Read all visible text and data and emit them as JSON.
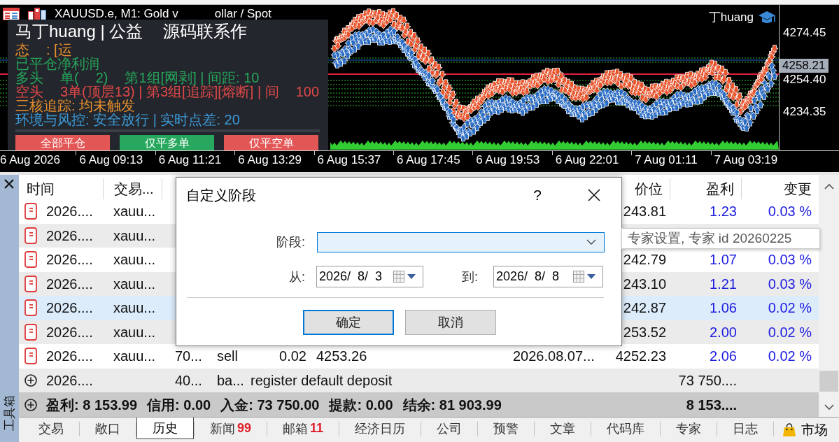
{
  "chart": {
    "title_parts": [
      "XAUUSD.e, M1: Gold v",
      "ollar / Spot"
    ],
    "author": "丁huang",
    "panel": {
      "lines": [
        {
          "color": "#ffffff",
          "parts": [
            "马丁huang | 公益",
            "源码联系作"
          ]
        },
        {
          "color": "#e8902e",
          "parts": [
            "态",
            ": [运"
          ]
        },
        {
          "color": "#26a65b",
          "parts": [
            "已平仓净利润"
          ]
        },
        {
          "color": "#26a65b",
          "parts": [
            "多头",
            "单(",
            "2)",
            "第1组[网剥] | 间距: 10"
          ]
        },
        {
          "color": "#e04848",
          "parts": [
            "空头",
            "3单(顶层13) | 第3组[追踪][熔断] | 间",
            "100"
          ]
        },
        {
          "color": "#e8902e",
          "parts": [
            "三核追踪: 均未触发"
          ]
        },
        {
          "color": "#3c9ad8",
          "parts": [
            "环境与风控: 安全放行 | 实时点差: 20"
          ]
        }
      ],
      "buttons": [
        {
          "label": "全部平仓",
          "color": "#e35656"
        },
        {
          "label": "仅平多单",
          "color": "#27a85e"
        },
        {
          "label": "仅平空单",
          "color": "#e35656"
        }
      ]
    },
    "price_ticks": [
      "4274.45",
      "4254.40",
      "4234.35"
    ],
    "current_price": "4258.21",
    "time_ticks": [
      "6 Aug 2026",
      "6 Aug 09:13",
      "6 Aug 11:21",
      "6 Aug 13:29",
      "6 Aug 15:37",
      "6 Aug 17:45",
      "6 Aug 19:53",
      "6 Aug 22:01",
      "7 Aug 01:11",
      "7 Aug 03:19"
    ]
  },
  "toolbox": {
    "title": "工具箱",
    "table": {
      "header": {
        "time": "时间",
        "symbol": "交易...",
        "close_price": "价位",
        "profit": "盈利",
        "change": "变更"
      },
      "rows": [
        {
          "kind": "deal",
          "selected": false,
          "time": "2026....",
          "symbol": "xauu...",
          "close_price": "243.81",
          "profit": "1.23",
          "change": "0.03 %"
        },
        {
          "kind": "deal",
          "selected": false,
          "time": "2026....",
          "symbol": "xauu..."
        },
        {
          "kind": "deal",
          "selected": false,
          "time": "2026....",
          "symbol": "xauu...",
          "close_price": "242.79",
          "profit": "1.07",
          "change": "0.03 %"
        },
        {
          "kind": "deal",
          "selected": false,
          "time": "2026....",
          "symbol": "xauu...",
          "close_price": "243.10",
          "profit": "1.21",
          "change": "0.03 %"
        },
        {
          "kind": "deal",
          "selected": true,
          "time": "2026....",
          "symbol": "xauu...",
          "close_price": "242.87",
          "profit": "1.06",
          "change": "0.02 %"
        },
        {
          "kind": "deal",
          "selected": false,
          "time": "2026....",
          "symbol": "xauu...",
          "close_price": "253.52",
          "profit": "2.00",
          "change": "0.02 %"
        },
        {
          "kind": "deal",
          "selected": false,
          "time": "2026....",
          "symbol": "xauu...",
          "ticket": "70...",
          "type": "sell",
          "volume": "0.02",
          "open_price": "4253.26",
          "close_time": "2026.08.07...",
          "close_price": "4252.23",
          "profit": "2.06",
          "change": "0.02 %"
        },
        {
          "kind": "balance",
          "selected": false,
          "time": "2026....",
          "ticket": "40...",
          "type": "ba...",
          "comment": "register default deposit",
          "profit": "73 750...."
        }
      ],
      "summary": {
        "items": [
          "盈利: 8 153.99",
          "信用: 0.00",
          "入金: 73 750.00",
          "提款: 0.00",
          "结余: 81 903.99"
        ],
        "profit": "8 153...."
      }
    },
    "tabs": [
      {
        "label": "交易",
        "selected": false
      },
      {
        "label": "敞口",
        "selected": false
      },
      {
        "label": "历史",
        "selected": true
      },
      {
        "label": "新闻",
        "badge": "99",
        "selected": false
      },
      {
        "label": "邮箱",
        "badge": "11",
        "selected": false
      },
      {
        "label": "经济日历",
        "selected": false
      },
      {
        "label": "公司",
        "selected": false
      },
      {
        "label": "预警",
        "selected": false
      },
      {
        "label": "文章",
        "selected": false
      },
      {
        "label": "代码库",
        "selected": false
      },
      {
        "label": "专家",
        "selected": false
      },
      {
        "label": "日志",
        "selected": false
      }
    ],
    "market": "市场"
  },
  "dialog": {
    "title": "自定义阶段",
    "help": "?",
    "period": {
      "label": "阶段:",
      "focused": true
    },
    "from": {
      "label": "从:",
      "value": "2026/  8/  3"
    },
    "to": {
      "label": "到:",
      "value": "2026/  8/  8"
    },
    "buttons": [
      {
        "label": "确定",
        "default": true
      },
      {
        "label": "取消",
        "default": false
      }
    ]
  },
  "tooltip": "专家设置, 专家 id 20260225"
}
